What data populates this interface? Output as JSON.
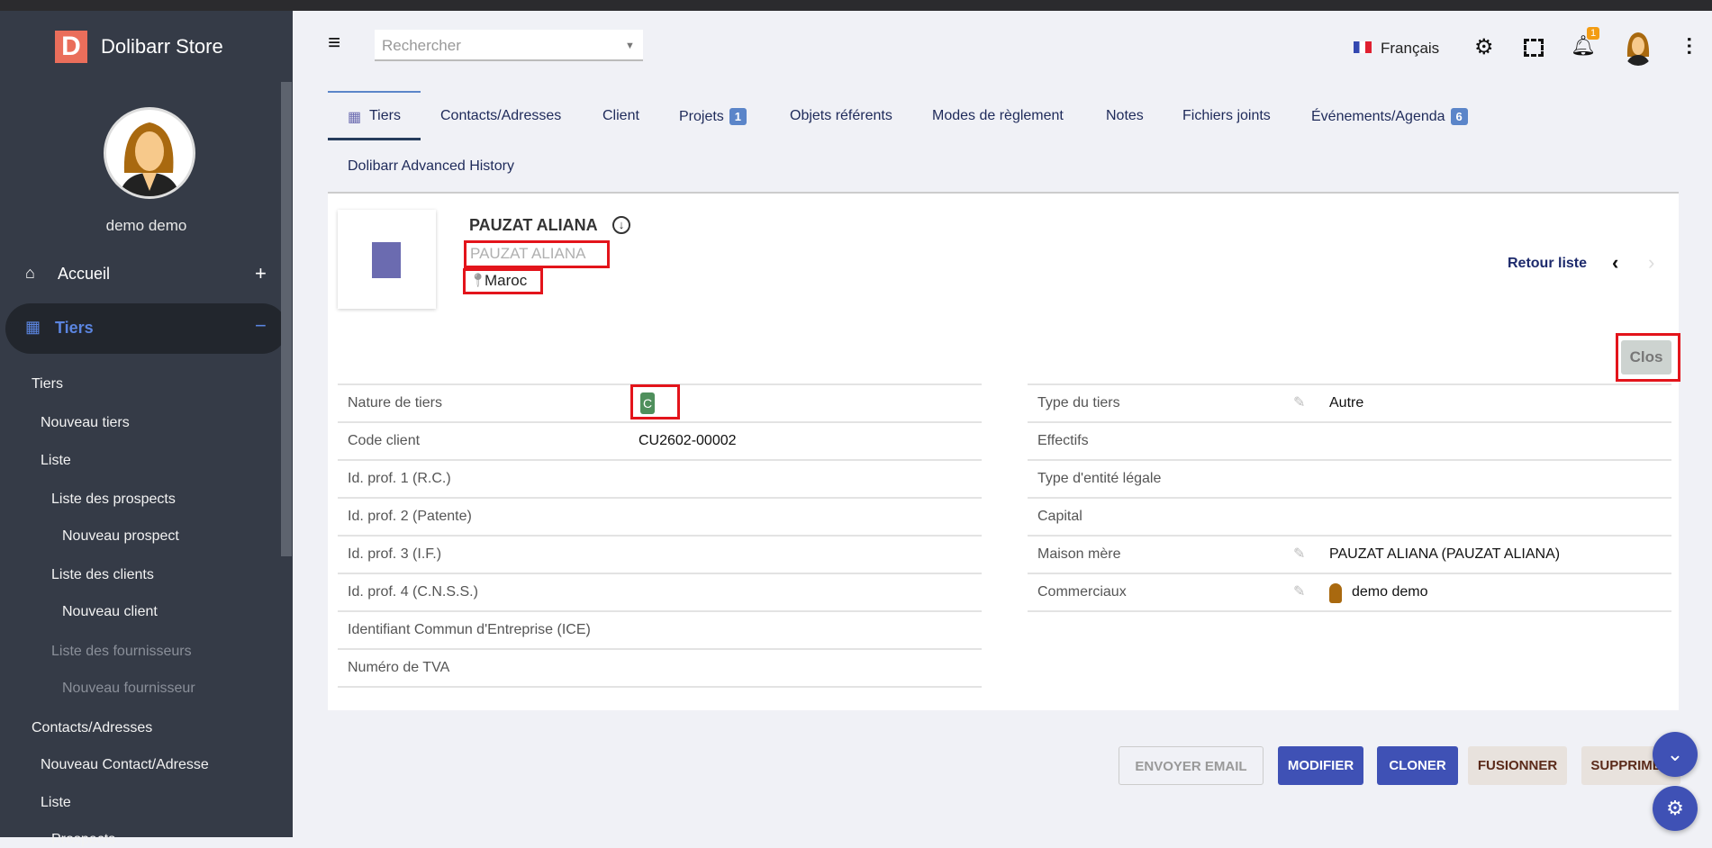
{
  "sidebar": {
    "brand": "Dolibarr Store",
    "logo_letter": "D",
    "user": "demo demo",
    "accueil": "Accueil",
    "tiers": "Tiers",
    "items": [
      {
        "label": "Tiers"
      },
      {
        "label": "Nouveau tiers"
      },
      {
        "label": "Liste"
      },
      {
        "label": "Liste des prospects"
      },
      {
        "label": "Nouveau prospect"
      },
      {
        "label": "Liste des clients"
      },
      {
        "label": "Nouveau client"
      },
      {
        "label": "Liste des fournisseurs"
      },
      {
        "label": "Nouveau fournisseur"
      },
      {
        "label": "Contacts/Adresses"
      },
      {
        "label": "Nouveau Contact/Adresse"
      },
      {
        "label": "Liste"
      },
      {
        "label": "Prospects"
      }
    ]
  },
  "header": {
    "search_placeholder": "Rechercher",
    "language": "Français",
    "notif_count": "1"
  },
  "tabs": [
    {
      "label": "Tiers"
    },
    {
      "label": "Contacts/Adresses"
    },
    {
      "label": "Client"
    },
    {
      "label": "Projets",
      "badge": "1"
    },
    {
      "label": "Objets référents"
    },
    {
      "label": "Modes de règlement"
    },
    {
      "label": "Notes"
    },
    {
      "label": "Fichiers joints"
    },
    {
      "label": "Événements/Agenda",
      "badge": "6"
    },
    {
      "label": "Dolibarr Advanced History"
    }
  ],
  "company": {
    "name": "PAUZAT ALIANA",
    "alias": "PAUZAT ALIANA",
    "country": "Maroc",
    "back_label": "Retour liste",
    "status": "Clos"
  },
  "left_fields": [
    {
      "label": "Nature de tiers",
      "value": "C"
    },
    {
      "label": "Code client",
      "value": "CU2602-00002"
    },
    {
      "label": "Id. prof. 1 (R.C.)",
      "value": ""
    },
    {
      "label": "Id. prof. 2 (Patente)",
      "value": ""
    },
    {
      "label": "Id. prof. 3 (I.F.)",
      "value": ""
    },
    {
      "label": "Id. prof. 4 (C.N.S.S.)",
      "value": ""
    },
    {
      "label": "Identifiant Commun d'Entreprise (ICE)",
      "value": ""
    },
    {
      "label": "Numéro de TVA",
      "value": ""
    }
  ],
  "right_fields": [
    {
      "label": "Type du tiers",
      "value": "Autre"
    },
    {
      "label": "Effectifs",
      "value": ""
    },
    {
      "label": "Type d'entité légale",
      "value": ""
    },
    {
      "label": "Capital",
      "value": ""
    },
    {
      "label": "Maison mère",
      "value": "PAUZAT ALIANA (PAUZAT ALIANA)"
    },
    {
      "label": "Commerciaux",
      "value": "demo demo"
    }
  ],
  "actions": {
    "email": "ENVOYER EMAIL",
    "modify": "MODIFIER",
    "clone": "CLONER",
    "merge": "FUSIONNER",
    "delete": "SUPPRIMER"
  },
  "colors": {
    "primary": "#3f51b5",
    "sidebar": "#353b47",
    "badge_green": "#4f8f5c",
    "highlight": "#e3141b"
  }
}
